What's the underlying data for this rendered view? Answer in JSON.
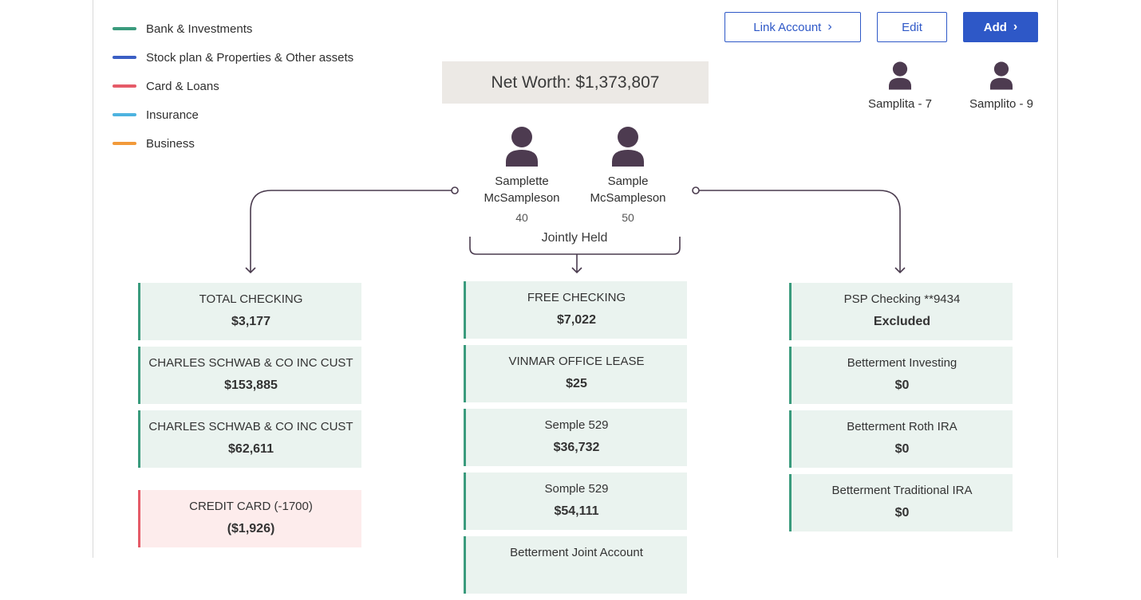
{
  "legend": [
    {
      "label": "Bank & Investments",
      "color": "#3a9b7d"
    },
    {
      "label": "Stock plan & Properties & Other assets",
      "color": "#3b5fc4"
    },
    {
      "label": "Card & Loans",
      "color": "#e55b68"
    },
    {
      "label": "Insurance",
      "color": "#4db3e0"
    },
    {
      "label": "Business",
      "color": "#f29a3a"
    }
  ],
  "toolbar": {
    "link_label": "Link Account",
    "edit_label": "Edit",
    "add_label": "Add"
  },
  "networth": "Net Worth: $1,373,807",
  "people": [
    {
      "name_line1": "Samplette",
      "name_line2": "McSampleson",
      "age": "40"
    },
    {
      "name_line1": "Sample",
      "name_line2": "McSampleson",
      "age": "50"
    }
  ],
  "kids": [
    {
      "label": "Samplita - 7"
    },
    {
      "label": "Samplito - 9"
    }
  ],
  "jointly_label": "Jointly Held",
  "columns": {
    "left": [
      {
        "title": "TOTAL CHECKING",
        "value": "$3,177",
        "kind": "bank"
      },
      {
        "title": "CHARLES SCHWAB & CO INC CUST",
        "value": "$153,885",
        "kind": "bank"
      },
      {
        "title": "CHARLES SCHWAB & CO INC CUST",
        "value": "$62,611",
        "kind": "bank"
      },
      {
        "title": "CREDIT CARD (-1700)",
        "value": "($1,926)",
        "kind": "loan"
      }
    ],
    "middle": [
      {
        "title": "FREE CHECKING",
        "value": "$7,022",
        "kind": "bank"
      },
      {
        "title": "VINMAR OFFICE LEASE",
        "value": "$25",
        "kind": "bank"
      },
      {
        "title": "Semple 529",
        "value": "$36,732",
        "kind": "bank"
      },
      {
        "title": "Somple 529",
        "value": "$54,111",
        "kind": "bank"
      },
      {
        "title": "Betterment Joint Account",
        "value": "",
        "kind": "bank"
      }
    ],
    "right": [
      {
        "title": "PSP Checking **9434",
        "value": "Excluded",
        "kind": "bank"
      },
      {
        "title": "Betterment Investing",
        "value": "$0",
        "kind": "bank"
      },
      {
        "title": "Betterment Roth IRA",
        "value": "$0",
        "kind": "bank"
      },
      {
        "title": "Betterment Traditional IRA",
        "value": "$0",
        "kind": "bank"
      }
    ]
  }
}
